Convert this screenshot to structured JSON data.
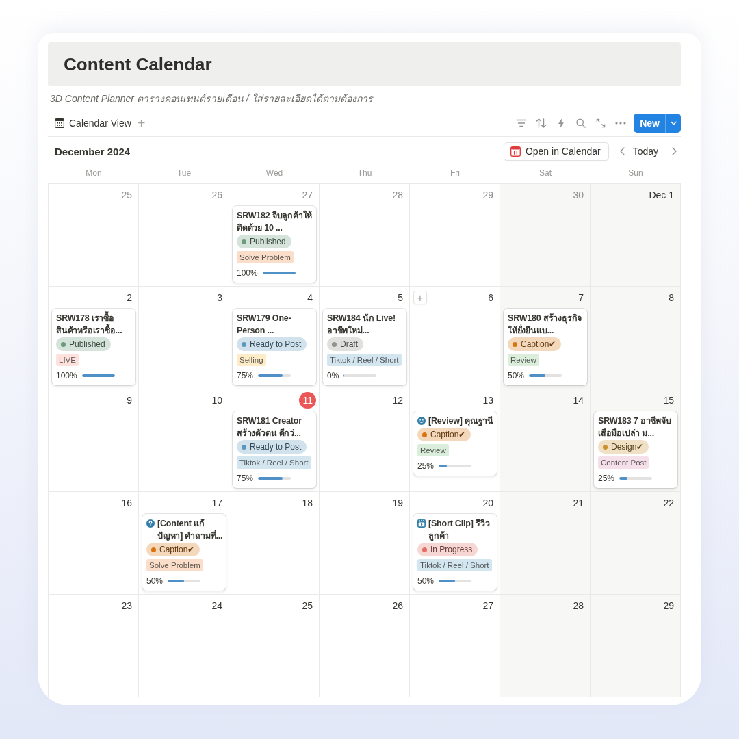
{
  "page": {
    "title": "Content Calendar",
    "subtitle": "3D Content Planner ตารางคอนเทนต์รายเดือน / ใส่รายละเอียดได้ตามต้องการ"
  },
  "toolbar": {
    "view_label": "Calendar View",
    "add_view": "+",
    "new_button": "New"
  },
  "calendar": {
    "month": "December 2024",
    "open_button": "Open in Calendar",
    "today_button": "Today",
    "weekdays": [
      {
        "label": "Mon",
        "color": "#ffffff"
      },
      {
        "label": "Tue",
        "color": "#ffffff"
      },
      {
        "label": "Wed",
        "color": "#ffffff"
      },
      {
        "label": "Thu",
        "color": "#ffffff"
      },
      {
        "label": "Fri",
        "color": "#ffffff"
      },
      {
        "label": "Sat",
        "color": "#f7f7f5"
      },
      {
        "label": "Sun",
        "color": "#f7f7f5"
      }
    ],
    "weeks": [
      {
        "days": [
          {
            "date": "25",
            "in_month": false,
            "today": false
          },
          {
            "date": "26",
            "in_month": false,
            "today": false
          },
          {
            "date": "27",
            "in_month": false,
            "today": false,
            "cards": [
              {
                "kind": "plain",
                "title": "SRW182 จีบลูกค้าให้ติดด้วย 10 ...",
                "status": {
                  "label": "Published",
                  "color": "#6c9b7d"
                },
                "tag": {
                  "label": "Solve Problem",
                  "color": "#fadec9"
                },
                "progress": {
                  "label": "100%",
                  "level": 1
                }
              }
            ]
          },
          {
            "date": "28",
            "in_month": false,
            "today": false
          },
          {
            "date": "29",
            "in_month": false,
            "today": false
          },
          {
            "date": "30",
            "in_month": false,
            "today": false
          },
          {
            "date": "Dec 1",
            "in_month": true,
            "today": false
          }
        ]
      },
      {
        "days": [
          {
            "date": "2",
            "in_month": true,
            "today": false,
            "cards": [
              {
                "kind": "plain",
                "title": "SRW178 เราซื้อสินค้าหรือเราซื้อ...",
                "status": {
                  "label": "Published",
                  "color": "#6c9b7d"
                },
                "tag": {
                  "label": "LIVE",
                  "color": "#ffe2dd"
                },
                "progress": {
                  "label": "100%",
                  "level": 1
                }
              }
            ]
          },
          {
            "date": "3",
            "in_month": true,
            "today": false
          },
          {
            "date": "4",
            "in_month": true,
            "today": false,
            "cards": [
              {
                "kind": "plain",
                "title": "SRW179 One-Person ...",
                "status": {
                  "label": "Ready to Post",
                  "color": "#5b97bd"
                },
                "tag": {
                  "label": "Selling",
                  "color": "#fdecc8"
                },
                "progress": {
                  "label": "75%",
                  "level": 0.75
                }
              }
            ]
          },
          {
            "date": "5",
            "in_month": true,
            "today": false,
            "cards": [
              {
                "kind": "plain",
                "title": "SRW184 นัก Live! อาชีพใหม่...",
                "status": {
                  "label": "Draft",
                  "color": "#91918e"
                },
                "tag": {
                  "label": "Tiktok / Reel / Short",
                  "color": "#d3e5ef"
                },
                "progress": {
                  "label": "0%",
                  "level": 0
                }
              }
            ]
          },
          {
            "date": "6",
            "in_month": true,
            "today": false,
            "add_label": "+"
          },
          {
            "date": "7",
            "in_month": true,
            "today": false,
            "cards": [
              {
                "kind": "plain",
                "title": "SRW180 สร้างธุรกิจให้ยั่งยืนแบ...",
                "status": {
                  "label": "Caption✔",
                  "color": "#d9730d"
                },
                "tag": {
                  "label": "Review",
                  "color": "#dbeddb"
                },
                "progress": {
                  "label": "50%",
                  "level": 0.5
                }
              }
            ]
          },
          {
            "date": "8",
            "in_month": true,
            "today": false
          }
        ]
      },
      {
        "days": [
          {
            "date": "9",
            "in_month": true,
            "today": false
          },
          {
            "date": "10",
            "in_month": true,
            "today": false
          },
          {
            "date": "11",
            "in_month": true,
            "today": true,
            "cards": [
              {
                "kind": "plain",
                "title": "SRW181 Creator สร้างตัวตน ดีกว่...",
                "status": {
                  "label": "Ready to Post",
                  "color": "#5b97bd"
                },
                "tag": {
                  "label": "Tiktok / Reel / Short",
                  "color": "#d3e5ef"
                },
                "progress": {
                  "label": "75%",
                  "level": 0.75
                }
              }
            ]
          },
          {
            "date": "12",
            "in_month": true,
            "today": false
          },
          {
            "date": "13",
            "in_month": true,
            "today": false,
            "cards": [
              {
                "kind": "smiley",
                "title": "[Review] คุณฐานี",
                "status": {
                  "label": "Caption✔",
                  "color": "#d9730d"
                },
                "tag": {
                  "label": "Review",
                  "color": "#dbeddb"
                },
                "progress": {
                  "label": "25%",
                  "level": 0.25
                }
              }
            ]
          },
          {
            "date": "14",
            "in_month": true,
            "today": false
          },
          {
            "date": "15",
            "in_month": true,
            "today": false,
            "cards": [
              {
                "kind": "plain",
                "title": "SRW183 7 อาชีพจับเสือมือเปล่า ม...",
                "status": {
                  "label": "Design✔",
                  "color": "#cb912f"
                },
                "tag": {
                  "label": "Content Post",
                  "color": "#f5e0e9"
                },
                "progress": {
                  "label": "25%",
                  "level": 0.25
                }
              }
            ]
          }
        ]
      },
      {
        "days": [
          {
            "date": "16",
            "in_month": true,
            "today": false
          },
          {
            "date": "17",
            "in_month": true,
            "today": false,
            "cards": [
              {
                "kind": "question",
                "title": "[Content แก้ปัญหา] คำถามที่...",
                "status": {
                  "label": "Caption✔",
                  "color": "#d9730d"
                },
                "tag": {
                  "label": "Solve Problem",
                  "color": "#fadec9"
                },
                "progress": {
                  "label": "50%",
                  "level": 0.5
                }
              }
            ]
          },
          {
            "date": "18",
            "in_month": true,
            "today": false
          },
          {
            "date": "19",
            "in_month": true,
            "today": false
          },
          {
            "date": "20",
            "in_month": true,
            "today": false,
            "cards": [
              {
                "kind": "clapper",
                "title": "[Short Clip] รีวิวลูกค้า",
                "status": {
                  "label": "In Progress",
                  "color": "#e16f64"
                },
                "tag": {
                  "label": "Tiktok / Reel / Short",
                  "color": "#d3e5ef"
                },
                "progress": {
                  "label": "50%",
                  "level": 0.5
                }
              }
            ]
          },
          {
            "date": "21",
            "in_month": true,
            "today": false
          },
          {
            "date": "22",
            "in_month": true,
            "today": false
          }
        ]
      },
      {
        "days": [
          {
            "date": "23",
            "in_month": true,
            "today": false
          },
          {
            "date": "24",
            "in_month": true,
            "today": false
          },
          {
            "date": "25",
            "in_month": true,
            "today": false
          },
          {
            "date": "26",
            "in_month": true,
            "today": false
          },
          {
            "date": "27",
            "in_month": true,
            "today": false
          },
          {
            "date": "28",
            "in_month": true,
            "today": false
          },
          {
            "date": "29",
            "in_month": true,
            "today": false
          }
        ]
      }
    ]
  }
}
